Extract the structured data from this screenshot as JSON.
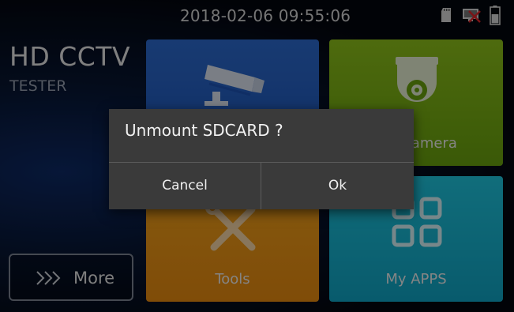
{
  "status_bar": {
    "datetime": "2018-02-06 09:55:06",
    "icons": [
      "sd-card-icon",
      "network-disconnected-icon",
      "battery-icon"
    ]
  },
  "brand": {
    "title": "HD CCTV",
    "subtitle": "TESTER"
  },
  "tiles": [
    {
      "id": "cctv",
      "label": "",
      "icon": "cctv-camera-icon",
      "color": "#2563c8"
    },
    {
      "id": "hd_camera",
      "label": "HD Camera",
      "icon": "dome-camera-icon",
      "color": "#7cb414"
    },
    {
      "id": "tools",
      "label": "Tools",
      "icon": "tools-icon",
      "color": "#f0981a"
    },
    {
      "id": "my_apps",
      "label": "My APPS",
      "icon": "apps-grid-icon",
      "color": "#19b8d6"
    }
  ],
  "more_button": {
    "label": "More",
    "icon": "triple-chevron-icon"
  },
  "dialog": {
    "title": "Unmount SDCARD ?",
    "cancel_label": "Cancel",
    "ok_label": "Ok"
  }
}
